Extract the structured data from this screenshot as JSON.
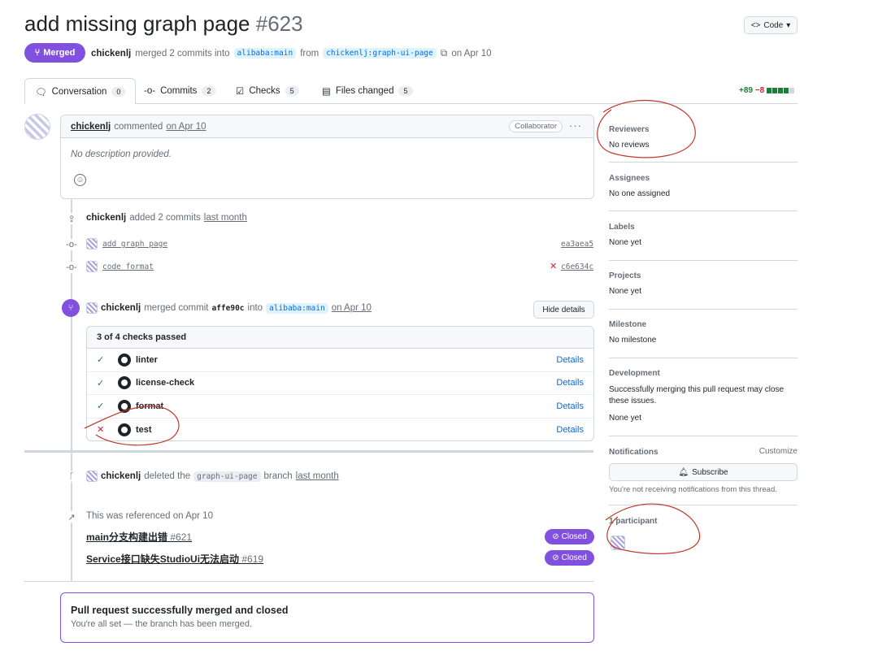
{
  "header": {
    "title": "add missing graph page",
    "number": "#623",
    "code_button": "Code",
    "status": "Merged",
    "author": "chickenlj",
    "merged_text": "merged 2 commits into",
    "base_branch": "alibaba:main",
    "from_text": "from",
    "head_branch": "chickenlj:graph-ui-page",
    "date_text": "on Apr 10"
  },
  "tabs": [
    {
      "label": "Conversation",
      "count": "0"
    },
    {
      "label": "Commits",
      "count": "2"
    },
    {
      "label": "Checks",
      "count": "5"
    },
    {
      "label": "Files changed",
      "count": "5"
    }
  ],
  "diffstat": {
    "added": "+89",
    "removed": "−8"
  },
  "comment": {
    "author": "chickenlj",
    "action": "commented",
    "date": "on Apr 10",
    "role": "Collaborator",
    "body": "No description provided."
  },
  "commits_event": {
    "author": "chickenlj",
    "action": "added 2 commits",
    "when": "last month",
    "commits": [
      {
        "message": "add graph page",
        "sha": "ea3aea5",
        "failed": false
      },
      {
        "message": "code format",
        "sha": "c6e634c",
        "failed": true
      }
    ]
  },
  "merge_event": {
    "author": "chickenlj",
    "action": "merged commit",
    "sha": "affe90c",
    "into_text": "into",
    "branch": "alibaba:main",
    "date": "on Apr 10",
    "hide_button": "Hide details"
  },
  "checks": {
    "summary": "3 of 4 checks passed",
    "items": [
      {
        "name": "linter",
        "status": "pass",
        "link": "Details"
      },
      {
        "name": "license-check",
        "status": "pass",
        "link": "Details"
      },
      {
        "name": "format",
        "status": "pass",
        "link": "Details"
      },
      {
        "name": "test",
        "status": "fail",
        "link": "Details"
      }
    ]
  },
  "delete_event": {
    "author": "chickenlj",
    "action": "deleted the",
    "branch": "graph-ui-page",
    "suffix": "branch",
    "when": "last month"
  },
  "references": {
    "header": "This was referenced on Apr 10",
    "items": [
      {
        "title": "main分支构建出错",
        "number": "#621",
        "state": "Closed"
      },
      {
        "title": "Service接口缺失StudioUi无法启动",
        "number": "#619",
        "state": "Closed"
      }
    ]
  },
  "merge_status": {
    "title": "Pull request successfully merged and closed",
    "subtitle": "You're all set — the branch has been merged."
  },
  "sidebar": {
    "reviewers": {
      "title": "Reviewers",
      "value": "No reviews"
    },
    "assignees": {
      "title": "Assignees",
      "value": "No one assigned"
    },
    "labels": {
      "title": "Labels",
      "value": "None yet"
    },
    "projects": {
      "title": "Projects",
      "value": "None yet"
    },
    "milestone": {
      "title": "Milestone",
      "value": "No milestone"
    },
    "development": {
      "title": "Development",
      "value": "Successfully merging this pull request may close these issues.",
      "value2": "None yet"
    },
    "notifications": {
      "title": "Notifications",
      "customize": "Customize",
      "button": "Subscribe",
      "note": "You're not receiving notifications from this thread."
    },
    "participants": {
      "title": "1 participant"
    }
  },
  "colors": {
    "merged": "#8250df",
    "link": "#0969da",
    "success": "#1a7f37",
    "danger": "#cf222e",
    "annotation": "#c0392b"
  }
}
